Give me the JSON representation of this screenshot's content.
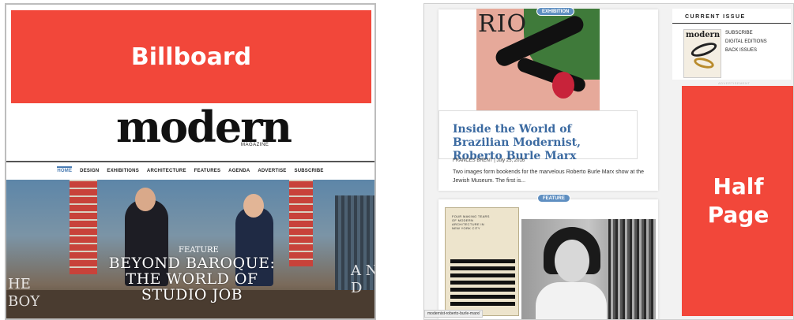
{
  "left": {
    "billboard_label": "Billboard",
    "logo_word": "modern",
    "logo_sub": "MAGAZINE",
    "nav": [
      "HOME",
      "DESIGN",
      "EXHIBITIONS",
      "ARCHITECTURE",
      "FEATURES",
      "AGENDA",
      "ADVERTISE",
      "SUBSCRIBE"
    ],
    "nav_active": "HOME",
    "hero": {
      "kicker": "FEATURE",
      "headline": "BEYOND BAROQUE: THE WORLD OF STUDIO JOB",
      "side_left": "HE\nBOY",
      "side_right": "A N\nD"
    },
    "colors": {
      "ad_red": "#f2473a",
      "link_blue": "#4a7cb3"
    }
  },
  "right": {
    "story1": {
      "badge": "EXHIBITION",
      "art_text": "RIO",
      "title": "Inside the World of Brazilian Modernist, Roberto Burle Marx",
      "byline": "FRANCES BRENT | July 25, 2016",
      "excerpt": "Two images form bookends for the marvelous Roberto Burle Marx show at the Jewish Museum. The first is..."
    },
    "story2": {
      "badge": "FEATURE",
      "book_text": "FOUR MAKING TEARS OF MODERN ARCHITECTURE IN NEW YORK CITY"
    },
    "status_url": "modernist-roberto-burle-marx/",
    "current_issue": {
      "title": "CURRENT ISSUE",
      "cover_word": "modern",
      "links": [
        "SUBSCRIBE",
        "DIGITAL EDITIONS",
        "BACK ISSUES"
      ]
    },
    "ad_label": "ADVERTISEMENT",
    "halfpage_label": "Half Page"
  }
}
